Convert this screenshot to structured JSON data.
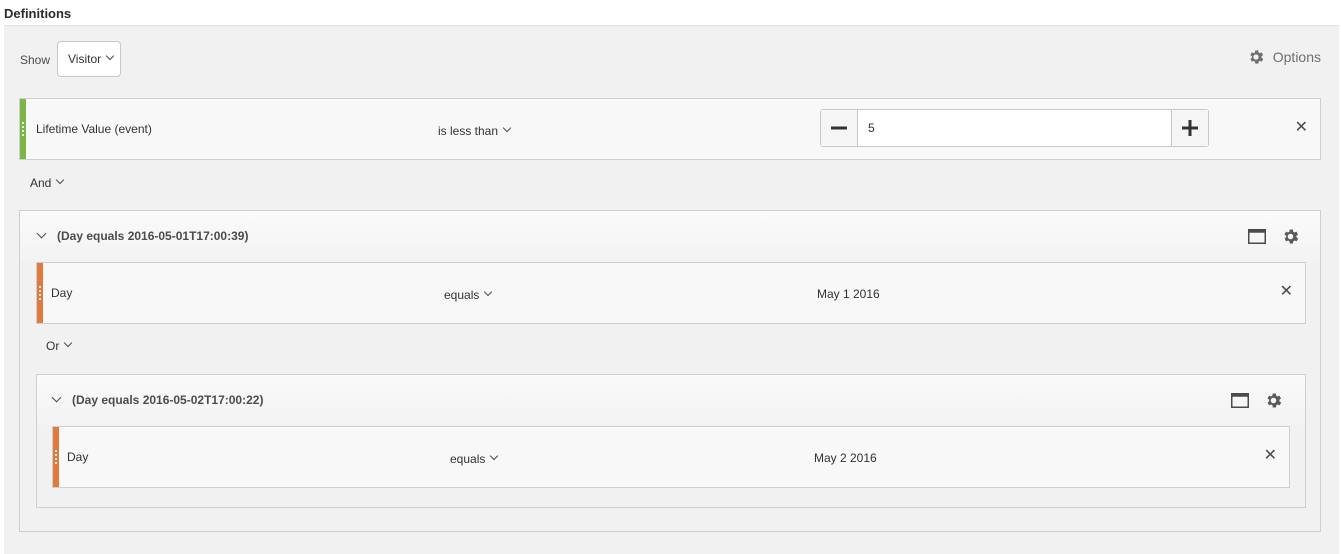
{
  "definitions": {
    "title": "Definitions",
    "show_label": "Show",
    "show_value": "Visitor",
    "options_label": "Options"
  },
  "rule1": {
    "dimension": "Lifetime Value (event)",
    "operator": "is less than",
    "value": "5",
    "color": "#7cb647"
  },
  "connector1": "And",
  "container1": {
    "title": "(Day equals 2016-05-01T17:00:39)",
    "rule": {
      "dimension": "Day",
      "operator": "equals",
      "value": "May 1 2016",
      "color": "#e07a3f"
    }
  },
  "connector2": "Or",
  "container2": {
    "title": "(Day equals 2016-05-02T17:00:22)",
    "rule": {
      "dimension": "Day",
      "operator": "equals",
      "value": "May 2 2016",
      "color": "#e07a3f"
    }
  },
  "icons": [
    "gear-icon",
    "chevron-down-icon",
    "minus-icon",
    "plus-icon",
    "close-icon",
    "collapse-chevron-icon",
    "window-icon"
  ]
}
